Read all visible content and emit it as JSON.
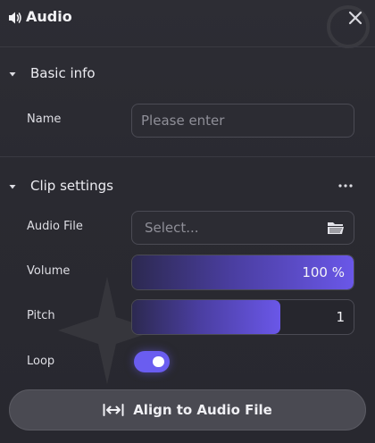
{
  "window": {
    "title": "Audio",
    "close_icon": "close-icon",
    "speaker_icon": "speaker-icon"
  },
  "basic_info": {
    "label": "Basic info",
    "name_label": "Name",
    "name_placeholder": "Please enter"
  },
  "clip_settings": {
    "label": "Clip settings",
    "audio_file_label": "Audio File",
    "audio_file_placeholder": "Select...",
    "volume_label": "Volume",
    "volume_value": 100,
    "volume_text": "100 %",
    "pitch_label": "Pitch",
    "pitch_value": 1,
    "pitch_fill_fraction": 0.67,
    "pitch_text": "1",
    "loop_label": "Loop",
    "loop_on": true
  },
  "align_button": {
    "label": "Align to Audio File",
    "icon": "align-arrows-icon"
  },
  "colors": {
    "accent": "#6a5df0",
    "background": "#2a2a31",
    "button": "#4a4a52"
  }
}
